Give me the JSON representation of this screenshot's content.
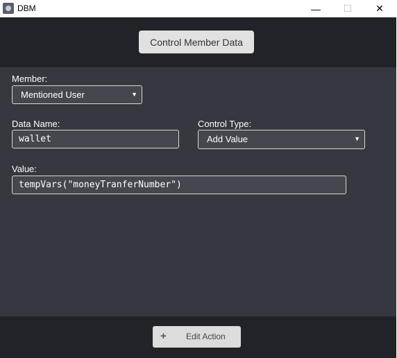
{
  "window": {
    "title": "DBM",
    "icon": "dbm-app-icon",
    "controls": {
      "minimize": "—",
      "maximize": "☐",
      "close": "✕"
    }
  },
  "header": {
    "action_title": "Control Member Data"
  },
  "form": {
    "member": {
      "label": "Member:",
      "value": "Mentioned User"
    },
    "data_name": {
      "label": "Data Name:",
      "value": "wallet"
    },
    "control_type": {
      "label": "Control Type:",
      "value": "Add Value"
    },
    "value": {
      "label": "Value:",
      "value": "tempVars(\"moneyTranferNumber\")"
    }
  },
  "footer": {
    "edit_icon": "+",
    "edit_label": "Edit Action"
  },
  "colors": {
    "header_bg": "#222328",
    "panel_bg": "#36383f",
    "field_bg": "#45474f",
    "button_bg": "#e1e1e1"
  }
}
